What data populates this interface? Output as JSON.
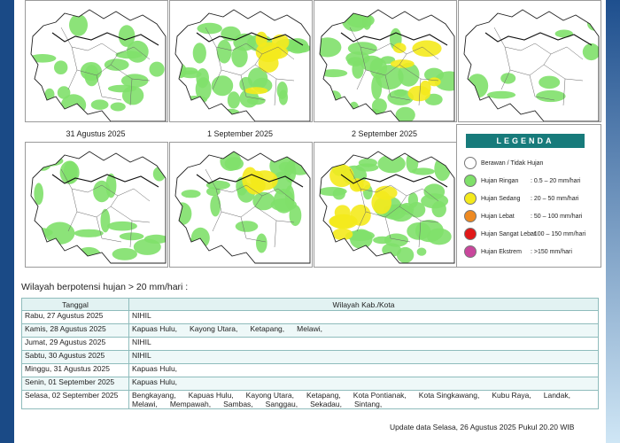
{
  "maps": [
    {
      "title": "",
      "rain": "light"
    },
    {
      "title": "",
      "rain": "moderate-east"
    },
    {
      "title": "",
      "rain": "moderate-east"
    },
    {
      "title": "",
      "rain": "light-sparse"
    },
    {
      "title": "31 Agustus 2025",
      "rain": "light"
    },
    {
      "title": "1 September 2025",
      "rain": "moderate-south"
    },
    {
      "title": "2 September 2025",
      "rain": "moderate-west"
    }
  ],
  "legend": {
    "title": "LEGENDA",
    "items": [
      {
        "label": "Berawan / Tidak Hujan",
        "range": "",
        "color": "#ffffff"
      },
      {
        "label": "Hujan Ringan",
        "range": ": 0.5 – 20 mm/hari",
        "color": "#7fe06a"
      },
      {
        "label": "Hujan Sedang",
        "range": ": 20 – 50 mm/hari",
        "color": "#f4ea1c"
      },
      {
        "label": "Hujan Lebat",
        "range": ": 50 – 100 mm/hari",
        "color": "#ee8a22"
      },
      {
        "label": "Hujan Sangat Lebat",
        "range": ": 100 – 150 mm/hari",
        "color": "#e01818"
      },
      {
        "label": "Hujan Ekstrem",
        "range": ": >150 mm/hari",
        "color": "#c9479c"
      }
    ]
  },
  "subtitle": "Wilayah berpotensi hujan > 20 mm/hari :",
  "table": {
    "headers": [
      "Tanggal",
      "Wilayah Kab./Kota"
    ],
    "rows": [
      {
        "date": "Rabu, 27 Agustus 2025",
        "regions": [
          "NIHIL"
        ]
      },
      {
        "date": "Kamis, 28 Agustus 2025",
        "regions": [
          "Kapuas Hulu,",
          "Kayong Utara,",
          "Ketapang,",
          "Melawi,"
        ]
      },
      {
        "date": "Jumat, 29 Agustus 2025",
        "regions": [
          "NIHIL"
        ]
      },
      {
        "date": "Sabtu, 30 Agustus 2025",
        "regions": [
          "NIHIL"
        ]
      },
      {
        "date": "Minggu, 31 Agustus 2025",
        "regions": [
          "Kapuas Hulu,"
        ]
      },
      {
        "date": "Senin, 01 September 2025",
        "regions": [
          "Kapuas Hulu,"
        ]
      },
      {
        "date": "Selasa, 02 September 2025",
        "regions": [
          "Bengkayang,",
          "Kapuas Hulu,",
          "Kayong Utara,",
          "Ketapang,",
          "Kota Pontianak,",
          "Kota Singkawang,",
          "Kubu Raya,",
          "Landak,",
          "Melawi,",
          "Mempawah,",
          "Sambas,",
          "Sanggau,",
          "Sekadau,",
          "Sintang,"
        ]
      }
    ]
  },
  "update_text": "Update data Selasa, 26 Agustus 2025 Pukul 20.20 WIB"
}
